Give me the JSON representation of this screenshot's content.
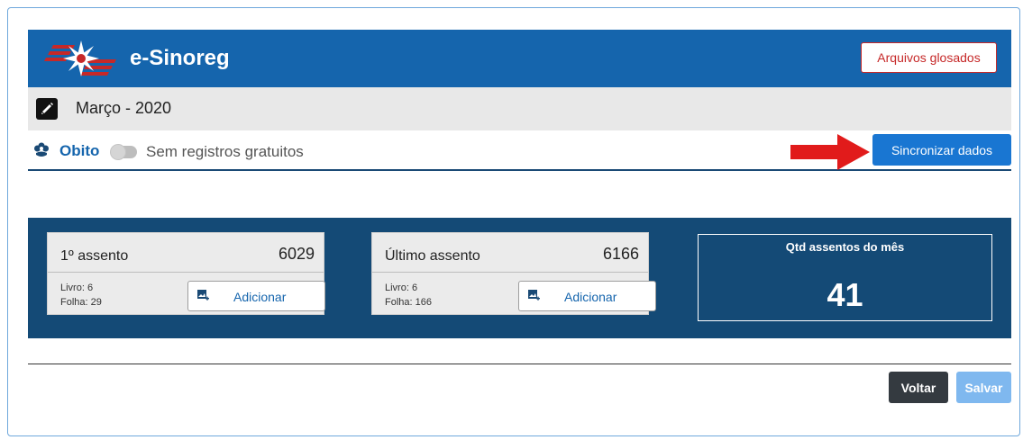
{
  "header": {
    "app_title": "e-Sinoreg",
    "glosados_label": "Arquivos glosados",
    "header_color": "#1565ad"
  },
  "period": {
    "label": "Março - 2020"
  },
  "record_type": {
    "icon": "flower-icon",
    "label": "Obito",
    "toggle_on": false,
    "toggle_label": "Sem registros gratuitos"
  },
  "sync": {
    "label": "Sincronizar dados",
    "color": "#1976d2"
  },
  "stats": {
    "first": {
      "title": "1º assento",
      "value": "6029",
      "livro": "Livro: 6",
      "folha": "Folha: 29",
      "add_label": "Adicionar"
    },
    "last": {
      "title": "Último assento",
      "value": "6166",
      "livro": "Livro: 6",
      "folha": "Folha: 166",
      "add_label": "Adicionar"
    },
    "month": {
      "title": "Qtd assentos do mês",
      "value": "41"
    },
    "panel_color": "#144a76"
  },
  "footer": {
    "back_label": "Voltar",
    "save_label": "Salvar"
  }
}
